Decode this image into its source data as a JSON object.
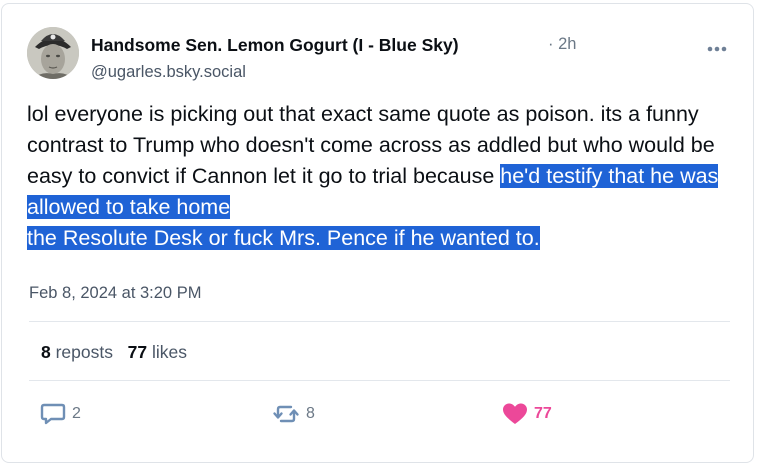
{
  "post": {
    "author": {
      "display_name": "Handsome Sen. Lemon Gogurt (I - Blue Sky)",
      "handle": "@ugarles.bsky.social",
      "time_ago": "· 2h"
    },
    "text_plain": "lol everyone is picking out that exact same quote as poison. its a funny contrast to Trump who doesn't come across as addled but who would be easy to convict if Cannon let it go to trial because ",
    "text_selected_line1": "he'd testify that he was allowed to take home",
    "text_selected_line2": "the Resolute Desk or fuck Mrs. Pence if he wanted to.",
    "date": "Feb 8, 2024 at 3:20 PM",
    "stats": {
      "reposts_count": "8",
      "reposts_label": "reposts",
      "likes_count": "77",
      "likes_label": "likes"
    },
    "actions": {
      "reply_count": "2",
      "repost_count": "8",
      "like_count": "77"
    }
  },
  "icons": {
    "more": "more-horizontal-icon",
    "reply": "comment-bubble-icon",
    "repost": "repost-arrows-icon",
    "like": "heart-icon"
  },
  "colors": {
    "selection_highlight": "#1f63d6",
    "like_pink": "#ec4899",
    "muted_text": "#4a5666",
    "icon_blue_gray": "#7b8fa7"
  }
}
